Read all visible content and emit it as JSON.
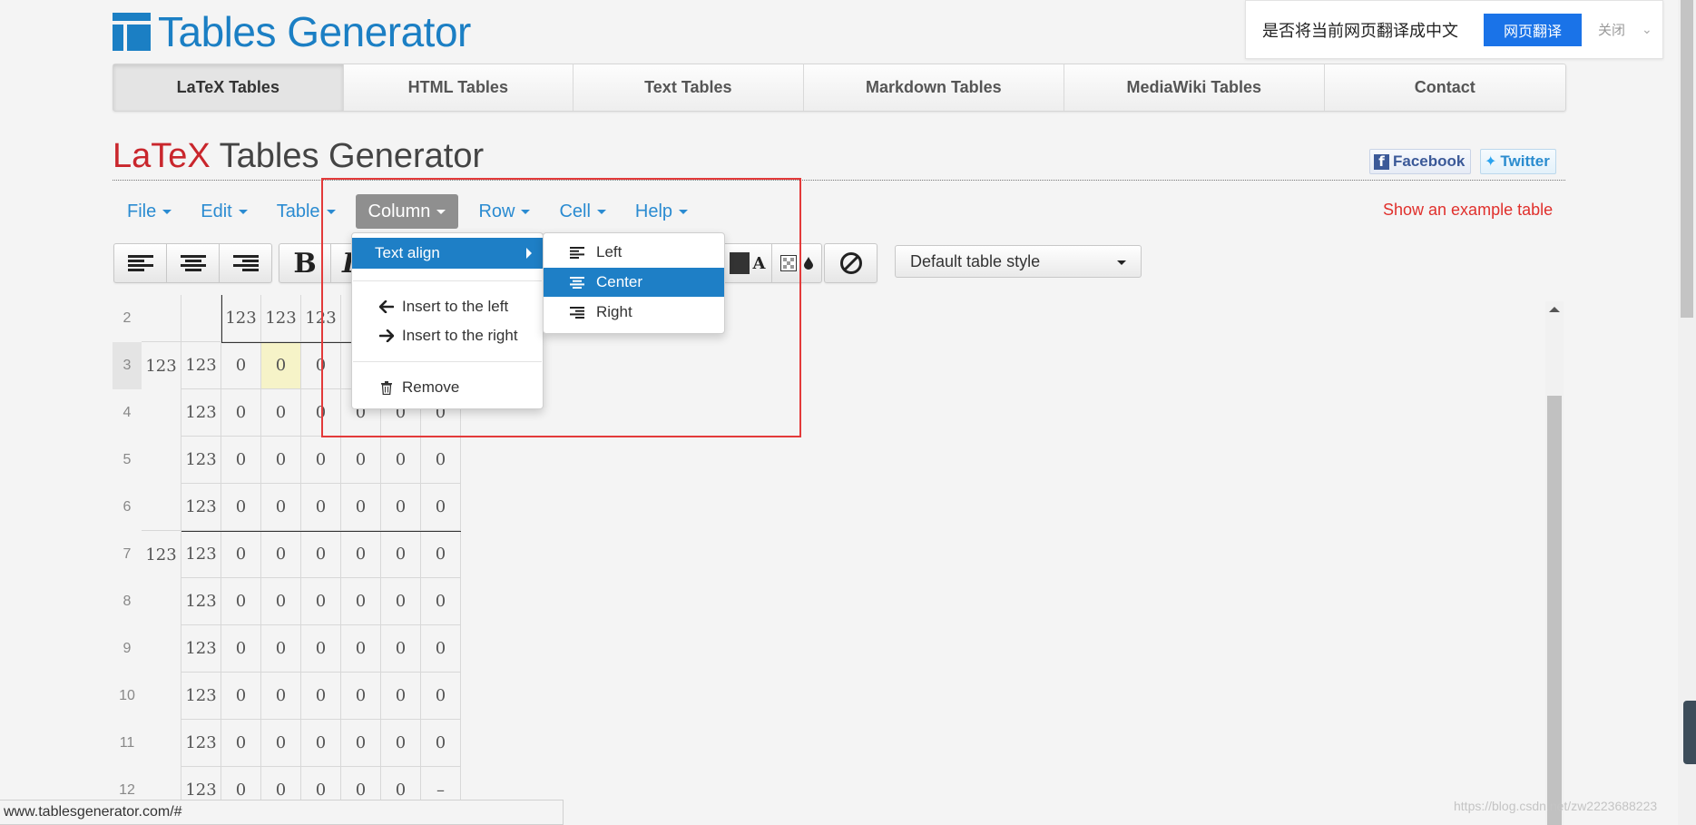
{
  "header": {
    "logo_text": "Tables Generator"
  },
  "translate_bar": {
    "prompt": "是否将当前网页翻译成中文",
    "translate_button": "网页翻译",
    "close_label": "关闭"
  },
  "tabs": [
    {
      "label": "LaTeX Tables",
      "active": true
    },
    {
      "label": "HTML Tables",
      "active": false
    },
    {
      "label": "Text Tables",
      "active": false
    },
    {
      "label": "Markdown Tables",
      "active": false
    },
    {
      "label": "MediaWiki Tables",
      "active": false
    },
    {
      "label": "Contact",
      "active": false
    }
  ],
  "page_title": {
    "brand": "LaTeX",
    "rest": " Tables Generator"
  },
  "social": {
    "facebook": "Facebook",
    "twitter": "Twitter"
  },
  "menu": {
    "items": [
      "File",
      "Edit",
      "Table",
      "Column",
      "Row",
      "Cell",
      "Help"
    ],
    "active": "Column"
  },
  "example_link": "Show an example table",
  "toolbar": {
    "bold": "B",
    "italic": "I",
    "text_color_letter": "A",
    "table_style": "Default table style"
  },
  "column_menu": {
    "text_align": "Text align",
    "insert_left": "Insert to the left",
    "insert_right": "Insert to the right",
    "remove": "Remove"
  },
  "text_align_submenu": {
    "left": "Left",
    "center": "Center",
    "right": "Right",
    "active": "Center"
  },
  "grid": {
    "row_numbers": [
      "2",
      "3",
      "4",
      "5",
      "6",
      "7",
      "8",
      "9",
      "10",
      "11",
      "12"
    ],
    "active_row": "3",
    "rows": [
      [
        "",
        "",
        "123",
        "123",
        "123",
        "",
        "",
        ""
      ],
      [
        "123",
        "123",
        "0",
        "0",
        "0",
        "",
        "",
        ""
      ],
      [
        "",
        "123",
        "0",
        "0",
        "0",
        "0",
        "0",
        "0"
      ],
      [
        "",
        "123",
        "0",
        "0",
        "0",
        "0",
        "0",
        "0"
      ],
      [
        "",
        "123",
        "0",
        "0",
        "0",
        "0",
        "0",
        "0"
      ],
      [
        "123",
        "123",
        "0",
        "0",
        "0",
        "0",
        "0",
        "0"
      ],
      [
        "",
        "123",
        "0",
        "0",
        "0",
        "0",
        "0",
        "0"
      ],
      [
        "",
        "123",
        "0",
        "0",
        "0",
        "0",
        "0",
        "0"
      ],
      [
        "",
        "123",
        "0",
        "0",
        "0",
        "0",
        "0",
        "0"
      ],
      [
        "",
        "123",
        "0",
        "0",
        "0",
        "0",
        "0",
        "0"
      ],
      [
        "",
        "123",
        "0",
        "0",
        "0",
        "0",
        "0",
        "–"
      ]
    ]
  },
  "status_url": "www.tablesgenerator.com/#",
  "watermark": "https://blog.csdn.net/zw2223688223",
  "colors": {
    "brand_blue": "#1b7fc4",
    "latex_red": "#c9262c",
    "menu_link": "#2a8bd1",
    "highlight": "#1e7fc6",
    "annotation_red": "#e33a3a",
    "selected_cell": "#f6f3c8"
  }
}
